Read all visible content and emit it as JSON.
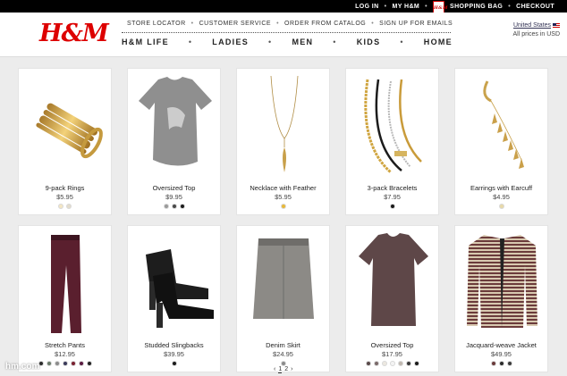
{
  "topbar": {
    "login": "LOG IN",
    "my_hm": "MY H&M",
    "shopping_bag": "SHOPPING BAG",
    "checkout": "CHECKOUT",
    "bag_logo_text": "H&M"
  },
  "header": {
    "logo": "H&M",
    "util_nav": [
      "STORE LOCATOR",
      "CUSTOMER SERVICE",
      "ORDER FROM CATALOG",
      "SIGN UP FOR EMAILS"
    ],
    "main_nav": [
      "H&M LIFE",
      "LADIES",
      "MEN",
      "KIDS",
      "HOME"
    ],
    "country": "United States",
    "currency_note": "All prices in USD"
  },
  "products": [
    {
      "name": "9-pack Rings",
      "price": "$5.95",
      "swatches": [
        "#f3e6c4",
        "#e3dccd"
      ]
    },
    {
      "name": "Oversized Top",
      "price": "$9.95",
      "swatches": [
        "#9a9a9a",
        "#4a4a4a",
        "#1c1c1c"
      ]
    },
    {
      "name": "Necklace with Feather",
      "price": "$5.95",
      "swatches": [
        "#e8b93a"
      ]
    },
    {
      "name": "3-pack Bracelets",
      "price": "$7.95",
      "swatches": [
        "#1a1a1a"
      ]
    },
    {
      "name": "Earrings with Earcuff",
      "price": "$4.95",
      "swatches": [
        "#e8d9a8"
      ]
    },
    {
      "name": "Stretch Pants",
      "price": "$12.95",
      "swatches": [
        "#2b2b2b",
        "#6a7a6a",
        "#8c8c8c",
        "#3a3a5a",
        "#7a2030",
        "#5a1a40",
        "#222222"
      ]
    },
    {
      "name": "Studded Slingbacks",
      "price": "$39.95",
      "swatches": [
        "#1a1a1a"
      ]
    },
    {
      "name": "Denim Skirt",
      "price": "$24.95",
      "swatches": [
        "#8a8a8a"
      ]
    },
    {
      "name": "Oversized Top",
      "price": "$17.95",
      "swatches": [
        "#5a4a4a",
        "#7a6a6a",
        "#ece8e0",
        "#f4f4f4",
        "#c0b8b0",
        "#3a3a3a",
        "#1a1a1a"
      ]
    },
    {
      "name": "Jacquard-weave Jacket",
      "price": "$49.95",
      "swatches": [
        "#6a3a3a",
        "#2a2a2a",
        "#3a3a3a"
      ]
    }
  ],
  "pagination": {
    "prev": "‹",
    "page1": "1",
    "page2": "2",
    "next": "›"
  },
  "watermark": "hm.com"
}
